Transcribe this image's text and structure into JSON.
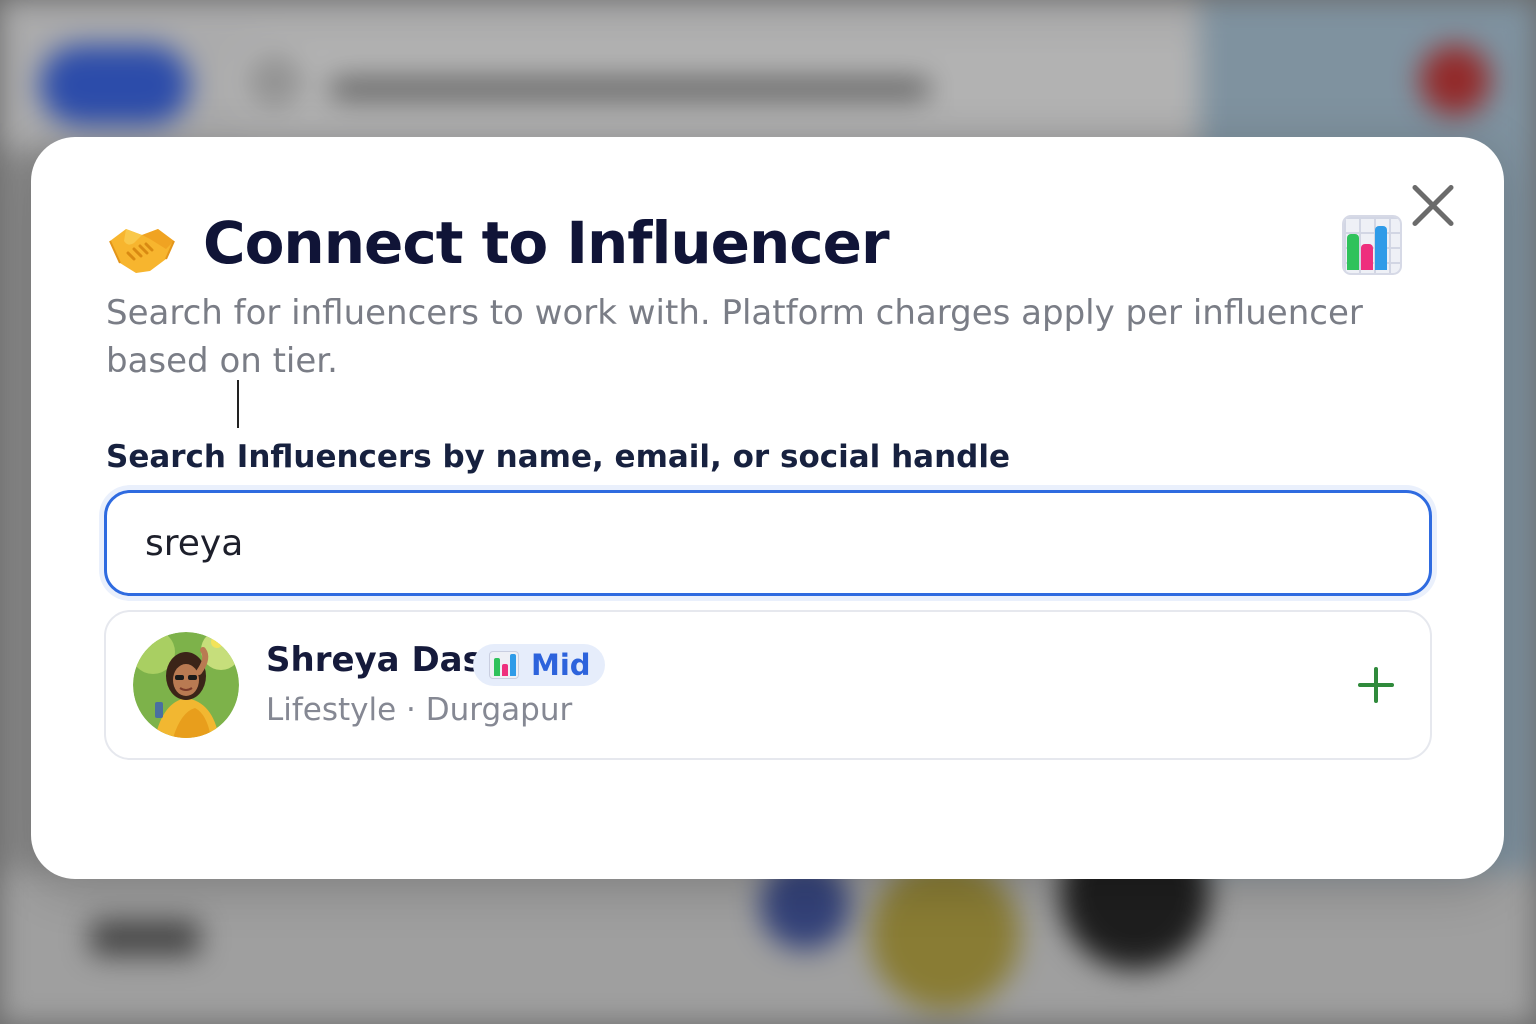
{
  "modal": {
    "title": "Connect to Influencer",
    "subtitle": "Search for influencers to work with. Platform charges apply per influencer based on tier.",
    "search_label": "Search Influencers by name, email, or social handle",
    "search_value": "sreya",
    "title_icon": "handshake-icon",
    "tier_icon": "bar-chart-icon",
    "close_icon": "close-icon"
  },
  "results": [
    {
      "name": "Shreya Das",
      "tier": "Mid",
      "meta": "Lifestyle · Durgapur",
      "action_icon": "plus-icon"
    }
  ],
  "colors": {
    "accent": "#2f6be0",
    "title": "#101437",
    "muted": "#7a7d86",
    "add": "#2f8a3b",
    "tier_badge_bg": "#e6edfb",
    "tier_badge_text": "#2d63dc"
  }
}
